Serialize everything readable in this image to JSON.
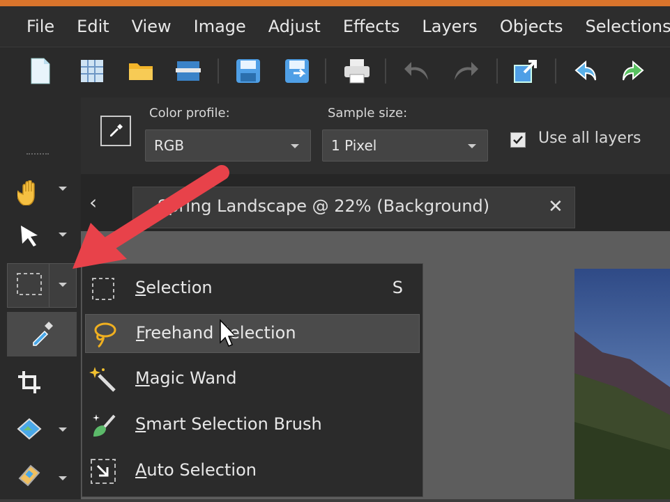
{
  "menubar": {
    "items": [
      "File",
      "Edit",
      "View",
      "Image",
      "Adjust",
      "Effects",
      "Layers",
      "Objects",
      "Selections"
    ]
  },
  "toolbar": {
    "buttons": [
      "new-document-icon",
      "grid-icon",
      "open-folder-icon",
      "scanner-icon",
      "save-icon",
      "save-as-icon",
      "print-icon",
      "undo-icon",
      "redo-icon",
      "export-icon",
      "rotate-left-icon",
      "rotate-right-icon"
    ]
  },
  "options": {
    "color_profile_label": "Color profile:",
    "color_profile_value": "RGB",
    "sample_size_label": "Sample size:",
    "sample_size_value": "1 Pixel",
    "use_all_layers_label": "Use all layers",
    "use_all_layers_checked": true
  },
  "document_tab": {
    "title": "Spring Landscape @  22% (Background)"
  },
  "selection_menu": {
    "items": [
      {
        "label": "Selection",
        "shortcut": "S",
        "icon": "rect-selection-icon"
      },
      {
        "label": "Freehand Selection",
        "shortcut": "",
        "icon": "lasso-icon"
      },
      {
        "label": "Magic Wand",
        "shortcut": "",
        "icon": "magic-wand-icon"
      },
      {
        "label": "Smart Selection Brush",
        "shortcut": "",
        "icon": "smart-brush-icon"
      },
      {
        "label": "Auto Selection",
        "shortcut": "",
        "icon": "auto-selection-icon"
      }
    ],
    "active_index": 1
  },
  "colors": {
    "accent_stripe": "#d9742c",
    "annotation_arrow": "#e8424a"
  }
}
